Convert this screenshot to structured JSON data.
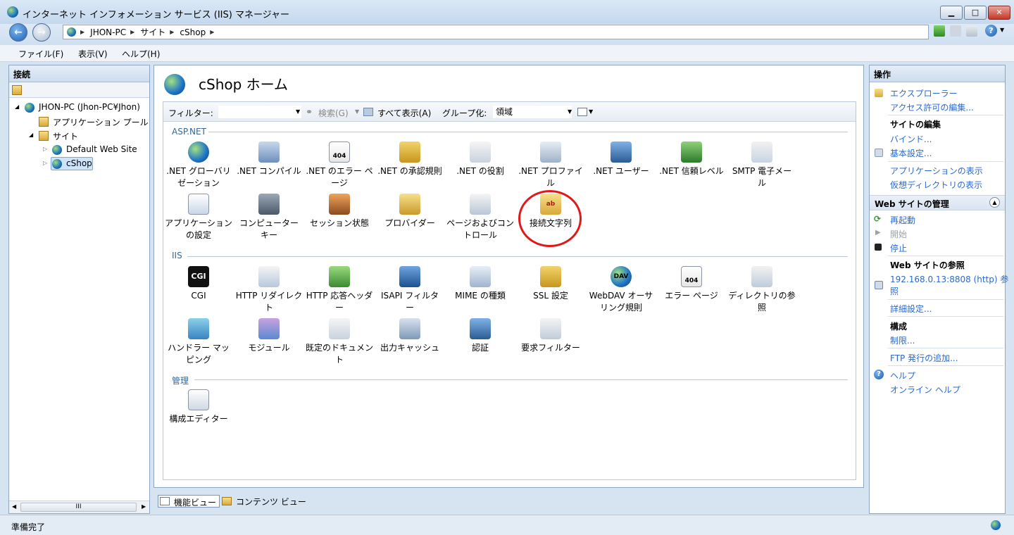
{
  "window": {
    "title": "インターネット インフォメーション サービス (IIS) マネージャー"
  },
  "address": {
    "crumbs": [
      "JHON-PC",
      "サイト",
      "cShop"
    ]
  },
  "menu": [
    "ファイル(F)",
    "表示(V)",
    "ヘルプ(H)"
  ],
  "connections": {
    "header": "接続",
    "tree": [
      {
        "label": "JHON-PC (Jhon-PC¥Jhon)"
      },
      {
        "label": "アプリケーション プール"
      },
      {
        "label": "サイト"
      },
      {
        "label": "Default Web Site"
      },
      {
        "label": "cShop"
      }
    ],
    "scroll_label": "III"
  },
  "center": {
    "title": "cShop ホーム",
    "filter_label": "フィルター:",
    "search_label": "検索(G)",
    "show_all_label": "すべて表示(A)",
    "group_label": "グループ化:",
    "group_value": "領域",
    "sections": {
      "aspnet": "ASP.NET",
      "iis": "IIS",
      "management": "管理"
    },
    "aspnet": [
      {
        "l1": ".NET グローバリ",
        "l2": "ゼーション"
      },
      {
        "l1": ".NET コンパイル",
        "l2": ""
      },
      {
        "l1": ".NET のエラー ペ",
        "l2": "ージ"
      },
      {
        "l1": ".NET の承認規則",
        "l2": ""
      },
      {
        "l1": ".NET の役割",
        "l2": ""
      },
      {
        "l1": ".NET プロファイ",
        "l2": "ル"
      },
      {
        "l1": ".NET ユーザー",
        "l2": ""
      },
      {
        "l1": ".NET 信頼レベル",
        "l2": ""
      },
      {
        "l1": "SMTP 電子メー",
        "l2": "ル"
      },
      {
        "l1": "アプリケーション",
        "l2": "の設定"
      },
      {
        "l1": "コンピューター",
        "l2": "キー"
      },
      {
        "l1": "セッション状態",
        "l2": ""
      },
      {
        "l1": "プロバイダー",
        "l2": ""
      },
      {
        "l1": "ページおよびコン",
        "l2": "トロール"
      },
      {
        "l1": "接続文字列",
        "l2": ""
      }
    ],
    "iis": [
      {
        "l1": "CGI",
        "l2": ""
      },
      {
        "l1": "HTTP リダイレク",
        "l2": "ト"
      },
      {
        "l1": "HTTP 応答ヘッダ",
        "l2": "ー"
      },
      {
        "l1": "ISAPI フィルタ",
        "l2": "ー"
      },
      {
        "l1": "MIME の種類",
        "l2": ""
      },
      {
        "l1": "SSL 設定",
        "l2": ""
      },
      {
        "l1": "WebDAV オーサ",
        "l2": "リング規則"
      },
      {
        "l1": "エラー ページ",
        "l2": ""
      },
      {
        "l1": "ディレクトリの参",
        "l2": "照"
      },
      {
        "l1": "ハンドラー マッ",
        "l2": "ピング"
      },
      {
        "l1": "モジュール",
        "l2": ""
      },
      {
        "l1": "既定のドキュメン",
        "l2": "ト"
      },
      {
        "l1": "出力キャッシュ",
        "l2": ""
      },
      {
        "l1": "認証",
        "l2": ""
      },
      {
        "l1": "要求フィルター",
        "l2": ""
      }
    ],
    "management": [
      {
        "l1": "構成エディター",
        "l2": ""
      }
    ],
    "icon_texts": {
      "cgi": "CGI",
      "err": "404",
      "dav": "DAV",
      "ab": "ab"
    }
  },
  "actions": {
    "header": "操作",
    "explore": "エクスプローラー",
    "edit_perm": "アクセス許可の編集...",
    "edit_site": "サイトの編集",
    "bindings": "バインド...",
    "basic": "基本設定...",
    "view_apps": "アプリケーションの表示",
    "view_vdirs": "仮想ディレクトリの表示",
    "manage_site": "Web サイトの管理",
    "restart": "再起動",
    "start": "開始",
    "stop": "停止",
    "browse_head": "Web サイトの参照",
    "browse_l1": "192.168.0.13:8808 (http) 参",
    "browse_l2": "照",
    "advanced": "詳細設定...",
    "config": "構成",
    "limits": "制限...",
    "ftp": "FTP 発行の追加...",
    "help": "ヘルプ",
    "online_help": "オンライン ヘルプ"
  },
  "views": {
    "features": "機能ビュー",
    "content": "コンテンツ ビュー"
  },
  "status": {
    "text": "準備完了"
  }
}
